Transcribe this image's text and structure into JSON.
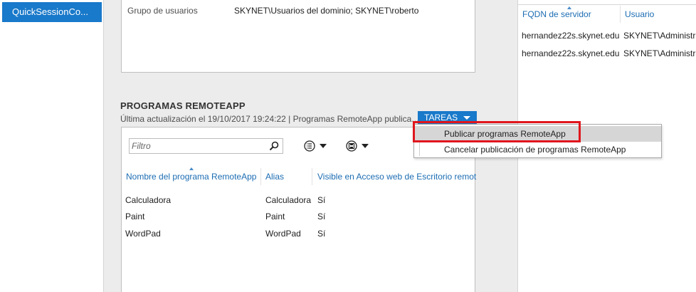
{
  "nav": {
    "selected_item": "QuickSessionCo..."
  },
  "properties": {
    "user_group_label": "Grupo de usuarios",
    "user_group_value": "SKYNET\\Usuarios del dominio; SKYNET\\roberto"
  },
  "remoteapp": {
    "title": "PROGRAMAS REMOTEAPP",
    "subtitle": "Última actualización el 19/10/2017 19:24:22 | Programas RemoteApp publica...",
    "tasks_label": "TAREAS",
    "filter_placeholder": "Filtro",
    "columns": [
      "Nombre del programa RemoteApp",
      "Alias",
      "Visible en Acceso web de Escritorio remot"
    ],
    "rows": [
      {
        "name": "Calculadora",
        "alias": "Calculadora",
        "visible": "Sí"
      },
      {
        "name": "Paint",
        "alias": "Paint",
        "visible": "Sí"
      },
      {
        "name": "WordPad",
        "alias": "WordPad",
        "visible": "Sí"
      }
    ]
  },
  "tasks_menu": {
    "items": [
      "Publicar programas RemoteApp",
      "Cancelar publicación de programas RemoteApp"
    ],
    "highlighted": "Publicar programas RemoteApp"
  },
  "servers": {
    "columns": [
      "FQDN de servidor",
      "Usuario"
    ],
    "rows": [
      {
        "fqdn": "hernandez22s.skynet.edu",
        "user": "SKYNET\\Administrador"
      },
      {
        "fqdn": "hernandez22s.skynet.edu",
        "user": "SKYNET\\Administrador"
      }
    ]
  },
  "colors": {
    "accent": "#1979ca",
    "header_link": "#1c6db3",
    "highlight_box": "#e0161d"
  },
  "icons": [
    "search-icon",
    "list-view-icon",
    "save-icon",
    "chevron-down-icon"
  ]
}
